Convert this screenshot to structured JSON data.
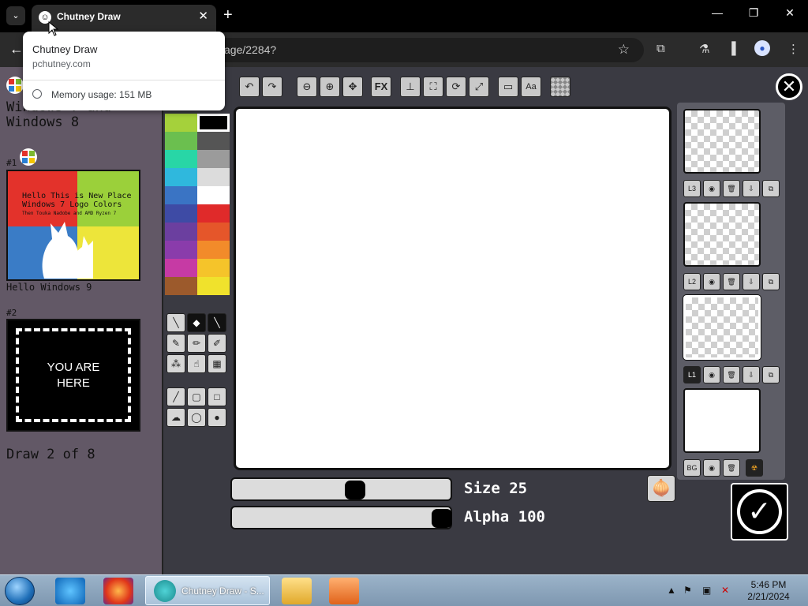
{
  "browser": {
    "tab_title": "Chutney Draw",
    "url_fragment": "age/2284?",
    "hovercard": {
      "title": "Chutney Draw",
      "host": "pchutney.com",
      "memory": "Memory usage: 151 MB"
    }
  },
  "thread": {
    "heading": "Windows 7 and\nWindows 8",
    "entries": [
      {
        "number": "#1",
        "image_text": [
          "Hello This is New Place",
          "Windows 7 Logo Colors",
          "Then Touka Nadobe and AMD Ryzen 7"
        ],
        "caption": "Hello Windows 9"
      },
      {
        "number": "#2",
        "image_text": "YOU ARE\nHERE"
      }
    ],
    "footer": "Draw 2 of 8"
  },
  "toolbar": {
    "icons": [
      "undo-icon",
      "redo-icon",
      "zoom-out-icon",
      "zoom-in-icon",
      "pan-icon",
      "fx-icon",
      "stamp-icon",
      "bucket-icon",
      "rotate-icon",
      "resize-icon",
      "selection-icon",
      "text-icon",
      "transparency-icon"
    ],
    "fx_label": "FX",
    "text_label": "Aa"
  },
  "palette": {
    "colors": [
      "#a5d13b",
      "#000000",
      "#6bbf4f",
      "#555555",
      "#28d6a6",
      "#9b9b9b",
      "#2fb8dd",
      "#dcdcdc",
      "#3a74c4",
      "#ffffff",
      "#3e4ba5",
      "#e02a2a",
      "#6b3f9f",
      "#e5562a",
      "#8a3cab",
      "#f28b2a",
      "#c63aa4",
      "#f5c42a",
      "#9c5a2c",
      "#f0e22c"
    ],
    "selected_index": 1
  },
  "tools": [
    "pen-icon",
    "eraser-icon",
    "brush-icon",
    "paint-brush-icon",
    "pencil-icon",
    "airbrush-icon",
    "spray-icon",
    "smudge-icon",
    "dither-icon",
    "line-icon",
    "rect-outline-icon",
    "rect-fill-icon",
    "lasso-icon",
    "ellipse-outline-icon",
    "ellipse-fill-icon"
  ],
  "sliders": {
    "size_label": "Size 25",
    "size_value": 25,
    "alpha_label": "Alpha 100",
    "alpha_value": 100
  },
  "layers": [
    {
      "label": "L3",
      "active": false
    },
    {
      "label": "L2",
      "active": false
    },
    {
      "label": "L1",
      "active": true
    },
    {
      "label": "BG",
      "active": false
    }
  ],
  "taskbar": {
    "active_app": "Chutney Draw - S...",
    "time": "5:46 PM",
    "date": "2/21/2024"
  },
  "colors": {
    "page_bg": "#3a3a42",
    "left_panel": "#625866",
    "taskbar": "#8aa3bb"
  }
}
